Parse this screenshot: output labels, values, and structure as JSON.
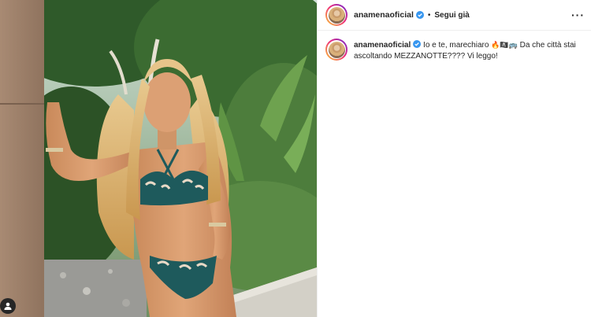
{
  "header": {
    "username": "anamenaoficial",
    "verified": true,
    "separator": "•",
    "follow_label": "Segui già",
    "more_label": "···"
  },
  "caption": {
    "username": "anamenaoficial",
    "text_part1": "Io e te, marechiaro ",
    "emojis": "🔥🏴‍☠️🚌",
    "text_part2": " Da che città stai ascoltando MEZZANOTTE???? Vi leggo!"
  },
  "photo": {
    "alt": "Woman in a printed bikini standing in a garden",
    "user_tag_icon": "user-tag-icon"
  },
  "colors": {
    "link_blue": "#0095f6",
    "verified_blue": "#3897f0",
    "text": "#262626",
    "border": "#efefef"
  }
}
